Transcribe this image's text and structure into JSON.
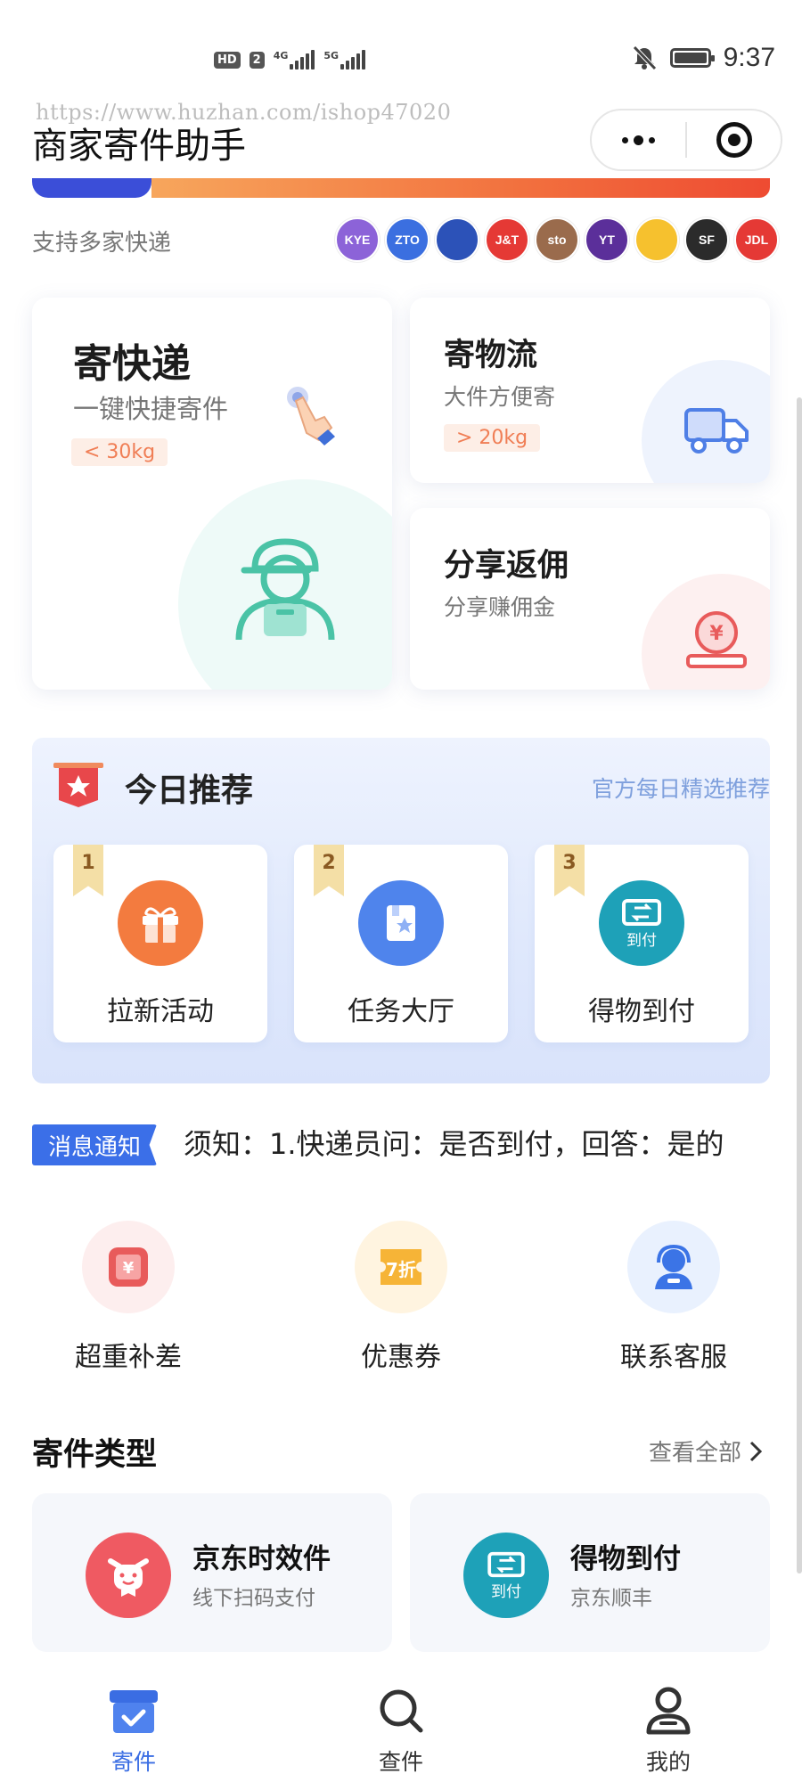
{
  "status_bar": {
    "hd_badge": "HD",
    "sim_badge": "2",
    "signal1_tag": "4G",
    "signal2_tag": "5G",
    "time": "9:37",
    "icons": [
      "signal-4g-icon",
      "signal-5g-icon",
      "mute-bell-icon",
      "battery-icon"
    ]
  },
  "watermark": "https://www.huzhan.com/ishop47020",
  "header": {
    "title": "商家寄件助手",
    "menu_icon": "more-dots-icon",
    "close_icon": "target-icon"
  },
  "carriers": {
    "label": "支持多家快递",
    "items": [
      {
        "text": "KYE",
        "color": "#8c63d8"
      },
      {
        "text": "ZTO",
        "color": "#3b6fe0"
      },
      {
        "text": "",
        "color": "#2c52b8"
      },
      {
        "text": "J&T",
        "color": "#e53935"
      },
      {
        "text": "sto",
        "color": "#9a6b4c"
      },
      {
        "text": "YT",
        "color": "#5b2f9a"
      },
      {
        "text": "",
        "color": "#f6c12e"
      },
      {
        "text": "SF",
        "color": "#2b2b2b"
      },
      {
        "text": "JDL",
        "color": "#e53935"
      }
    ]
  },
  "services": {
    "express": {
      "title": "寄快递",
      "subtitle": "一键快捷寄件",
      "tag": "< 30kg"
    },
    "logistics": {
      "title": "寄物流",
      "subtitle": "大件方便寄",
      "tag": "> 20kg"
    },
    "share": {
      "title": "分享返佣",
      "subtitle": "分享赚佣金"
    }
  },
  "recommend": {
    "title": "今日推荐",
    "subtitle": "官方每日精选推荐",
    "items": [
      {
        "rank": "1",
        "label": "拉新活动",
        "color": "#f37b3f",
        "icon": "gift-icon"
      },
      {
        "rank": "2",
        "label": "任务大厅",
        "color": "#4f84ec",
        "icon": "task-book-icon"
      },
      {
        "rank": "3",
        "label": "得物到付",
        "color": "#1ea1b8",
        "icon": "cod-icon",
        "icon_text": "到付"
      }
    ]
  },
  "notice": {
    "tag": "消息通知",
    "text": "须知：1.快递员问：是否到付，回答：是的"
  },
  "quick_actions": [
    {
      "label": "超重补差",
      "icon": "overweight-yuan-icon",
      "bg": "#fdeeee",
      "color": "#e85b5b"
    },
    {
      "label": "优惠券",
      "icon": "coupon-icon",
      "bg": "#fff4e0",
      "color": "#f6b437",
      "icon_text": "7折"
    },
    {
      "label": "联系客服",
      "icon": "customer-service-icon",
      "bg": "#e9f1fe",
      "color": "#3b74e6"
    }
  ],
  "send_types": {
    "title": "寄件类型",
    "view_all": "查看全部",
    "items": [
      {
        "title": "京东时效件",
        "subtitle": "线下扫码支付",
        "icon": "jd-dog-icon",
        "color": "#ef5a62"
      },
      {
        "title": "得物到付",
        "subtitle": "京东顺丰",
        "icon": "cod-icon",
        "color": "#1ea1b8",
        "icon_text": "到付"
      }
    ]
  },
  "tabbar": {
    "items": [
      {
        "label": "寄件",
        "icon": "package-icon",
        "active": true
      },
      {
        "label": "查件",
        "icon": "search-icon",
        "active": false
      },
      {
        "label": "我的",
        "icon": "user-icon",
        "active": false
      }
    ]
  },
  "colors": {
    "accent": "#3a6de3",
    "banner_gradient": [
      "#f7a65c",
      "#ee4b32"
    ],
    "banner_blue": "#3b4ed8"
  }
}
